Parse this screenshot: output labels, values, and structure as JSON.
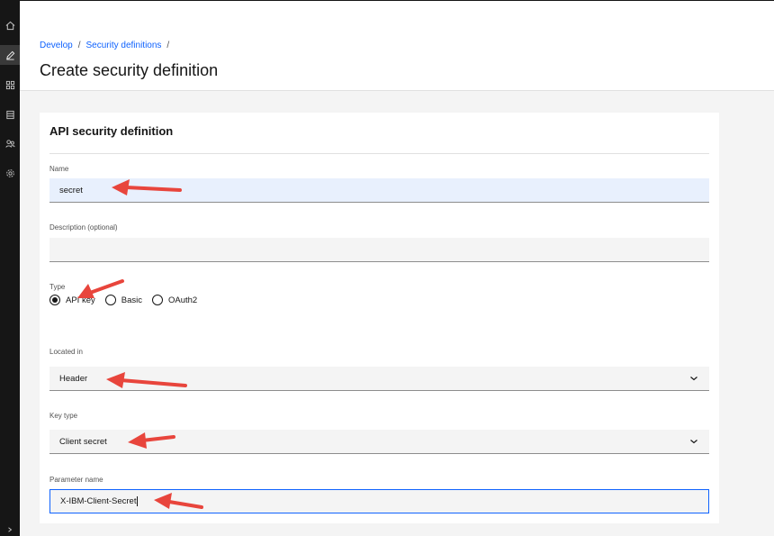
{
  "sidenav": {
    "items": [
      {
        "icon": "home-icon"
      },
      {
        "icon": "edit-icon",
        "active": true
      },
      {
        "icon": "grid-icon"
      },
      {
        "icon": "database-icon"
      },
      {
        "icon": "users-icon"
      },
      {
        "icon": "gear-icon"
      }
    ],
    "expand_icon": "chevron-right-icon"
  },
  "breadcrumb": {
    "items": [
      "Develop",
      "Security definitions"
    ],
    "separator": "/"
  },
  "page_title": "Create security definition",
  "form": {
    "section_title": "API security definition",
    "name": {
      "label": "Name",
      "value": "secret"
    },
    "description": {
      "label": "Description (optional)",
      "value": ""
    },
    "type": {
      "label": "Type",
      "options": [
        "API key",
        "Basic",
        "OAuth2"
      ],
      "selected": "API key"
    },
    "located_in": {
      "label": "Located in",
      "value": "Header"
    },
    "key_type": {
      "label": "Key type",
      "value": "Client secret"
    },
    "parameter_name": {
      "label": "Parameter name",
      "value": "X-IBM-Client-Secret"
    }
  },
  "colors": {
    "link": "#0f62fe",
    "annotation_arrow": "#e8453c",
    "sidenav_bg": "#161616"
  }
}
